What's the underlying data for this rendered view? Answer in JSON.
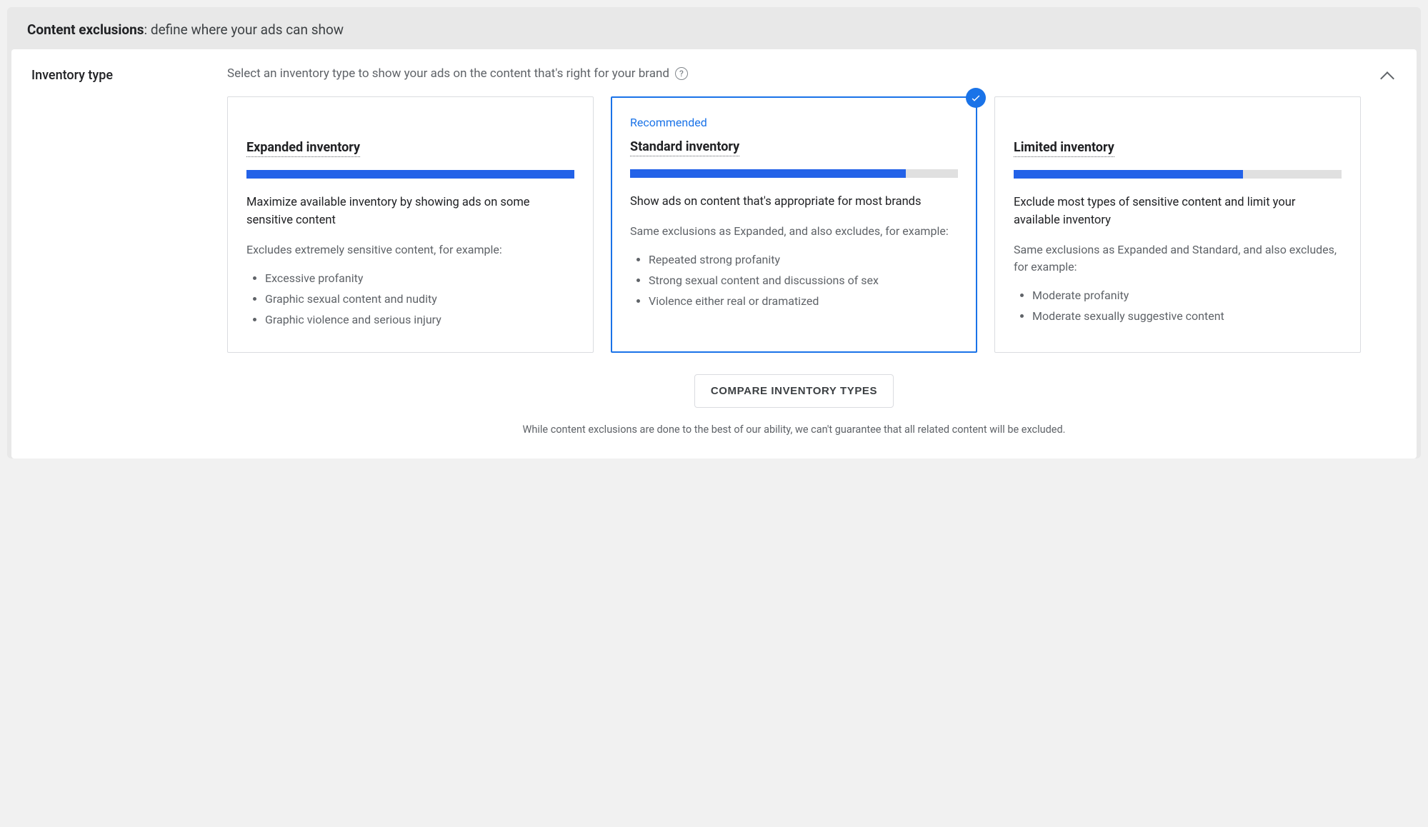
{
  "header": {
    "title_bold": "Content exclusions",
    "title_rest": ": define where your ads can show"
  },
  "section": {
    "label": "Inventory type",
    "instruction": "Select an inventory type to show your ads on the content that's right for your brand"
  },
  "cards": [
    {
      "id": "expanded",
      "recommended": "",
      "title": "Expanded inventory",
      "bar_pct": 100,
      "desc": "Maximize available inventory by showing ads on some sensitive content",
      "sub": "Excludes extremely sensitive content, for example:",
      "bullets": [
        "Excessive profanity",
        "Graphic sexual content and nudity",
        "Graphic violence and serious injury"
      ],
      "selected": false
    },
    {
      "id": "standard",
      "recommended": "Recommended",
      "title": "Standard inventory",
      "bar_pct": 84,
      "desc": "Show ads on content that's appropriate for most brands",
      "sub": "Same exclusions as Expanded, and also excludes, for example:",
      "bullets": [
        "Repeated strong profanity",
        "Strong sexual content and discussions of sex",
        "Violence either real or dramatized"
      ],
      "selected": true
    },
    {
      "id": "limited",
      "recommended": "",
      "title": "Limited inventory",
      "bar_pct": 70,
      "desc": "Exclude most types of sensitive content and limit your available inventory",
      "sub": "Same exclusions as Expanded and Standard, and also excludes, for example:",
      "bullets": [
        "Moderate profanity",
        "Moderate sexually suggestive content"
      ],
      "selected": false
    }
  ],
  "compare_label": "COMPARE INVENTORY TYPES",
  "disclaimer": "While content exclusions are done to the best of our ability, we can't guarantee that all related content will be excluded."
}
